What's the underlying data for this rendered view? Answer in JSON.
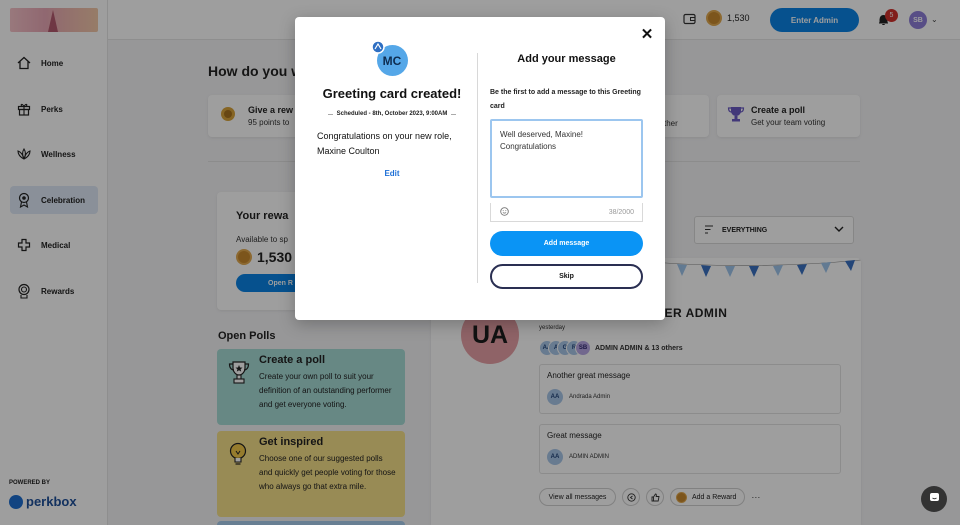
{
  "sidebar": {
    "items": [
      {
        "label": "Home",
        "icon": "home-icon"
      },
      {
        "label": "Perks",
        "icon": "gift-icon"
      },
      {
        "label": "Wellness",
        "icon": "lotus-icon"
      },
      {
        "label": "Celebration",
        "icon": "rosette-icon",
        "active": true
      },
      {
        "label": "Medical",
        "icon": "medical-cross-icon"
      },
      {
        "label": "Rewards",
        "icon": "rewards-medal-icon"
      }
    ],
    "powered_by": "POWERED BY",
    "brand": "perkbox"
  },
  "topbar": {
    "coins": "1,530",
    "enter_admin": "Enter Admin",
    "notifications": "5",
    "user_initials": "SB"
  },
  "page": {
    "heading": "How do you w",
    "action_cards": [
      {
        "title": "Give a rew",
        "subtitle": "95 points to"
      },
      {
        "title": "",
        "subtitle": "ther"
      },
      {
        "title": "Create a poll",
        "subtitle": "Get your team voting"
      }
    ],
    "rewards": {
      "title": "Your rewa",
      "available": "Available to sp",
      "balance": "1,530",
      "button": "Open R"
    },
    "open_polls": "Open Polls",
    "polls": [
      {
        "title": "Create a poll",
        "text": "Create your own poll to suit your definition of an outstanding performer and get everyone voting.",
        "color": "#a7dbd6"
      },
      {
        "title": "Get inspired",
        "text": "Choose one of our suggested polls and quickly get people voting for those who always go that extra mile.",
        "color": "#f6e08a"
      }
    ],
    "filter": "EVERYTHING",
    "feed": {
      "avatar": "UA",
      "name": "SER ADMIN",
      "when": "yesterday",
      "stack_initials": [
        "AA",
        "A",
        "G",
        "R",
        "SB"
      ],
      "stack_text": "ADMIN ADMIN & 13 others",
      "messages": [
        {
          "title": "Another great message",
          "author_initials": "AA",
          "author": "Andrada Admin"
        },
        {
          "title": "Great message",
          "author_initials": "AA",
          "author": "ADMIN ADMIN"
        }
      ],
      "view_all": "View all messages",
      "add_reward": "Add a Reward",
      "more": "···"
    }
  },
  "modal": {
    "avatar": "MC",
    "created_title": "Greeting card created!",
    "scheduled": "Scheduled - 8th, October 2023, 9:00AM",
    "congrats": "Congratulations on your new role, Maxine Coulton",
    "edit": "Edit",
    "right_title": "Add your message",
    "hint": "Be the first to add a message to this Greeting card",
    "message_value": "Well deserved, Maxine!\nCongratulations",
    "counter": "38/2000",
    "add_message": "Add message",
    "skip": "Skip"
  },
  "colors": {
    "primary": "#0a84e6",
    "active_nav": "#dfe9f7",
    "badge": "#d0312d"
  }
}
